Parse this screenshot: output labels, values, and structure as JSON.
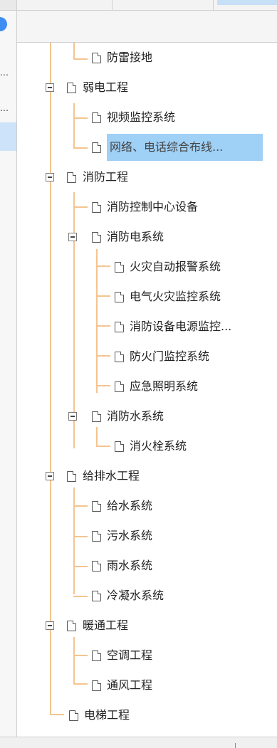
{
  "left_panel": {
    "ellipsis_1": "…",
    "ellipsis_2": "…"
  },
  "tree": {
    "nodes": [
      {
        "label": "防雷接地",
        "icon": "document-icon",
        "expander": false
      },
      {
        "label": "弱电工程",
        "icon": "document-icon",
        "expander": "expanded"
      },
      {
        "label": "视频监控系统",
        "icon": "document-icon",
        "expander": false
      },
      {
        "label": "网络、电话综合布线...",
        "icon": "document-icon",
        "expander": false,
        "selected": true
      },
      {
        "label": "消防工程",
        "icon": "document-icon",
        "expander": "expanded"
      },
      {
        "label": "消防控制中心设备",
        "icon": "document-icon",
        "expander": false
      },
      {
        "label": "消防电系统",
        "icon": "document-icon",
        "expander": "expanded"
      },
      {
        "label": "火灾自动报警系统",
        "icon": "document-icon",
        "expander": false
      },
      {
        "label": "电气火灾监控系统",
        "icon": "document-icon",
        "expander": false
      },
      {
        "label": "消防设备电源监控...",
        "icon": "document-icon",
        "expander": false
      },
      {
        "label": "防火门监控系统",
        "icon": "document-icon",
        "expander": false
      },
      {
        "label": "应急照明系统",
        "icon": "document-icon",
        "expander": false
      },
      {
        "label": "消防水系统",
        "icon": "document-icon",
        "expander": "expanded"
      },
      {
        "label": "消火栓系统",
        "icon": "document-icon",
        "expander": false
      },
      {
        "label": "给排水工程",
        "icon": "document-icon",
        "expander": "expanded"
      },
      {
        "label": "给水系统",
        "icon": "document-icon",
        "expander": false
      },
      {
        "label": "污水系统",
        "icon": "document-icon",
        "expander": false
      },
      {
        "label": "雨水系统",
        "icon": "document-icon",
        "expander": false
      },
      {
        "label": "冷凝水系统",
        "icon": "document-icon",
        "expander": false
      },
      {
        "label": "暖通工程",
        "icon": "document-icon",
        "expander": "expanded"
      },
      {
        "label": "空调工程",
        "icon": "document-icon",
        "expander": false
      },
      {
        "label": "通风工程",
        "icon": "document-icon",
        "expander": false
      },
      {
        "label": "电梯工程",
        "icon": "document-icon",
        "expander": false
      }
    ]
  },
  "colors": {
    "tree_line": "#f4c490",
    "selected_bg": "#9fd0f6",
    "accent_blue": "#3d8ef0"
  }
}
